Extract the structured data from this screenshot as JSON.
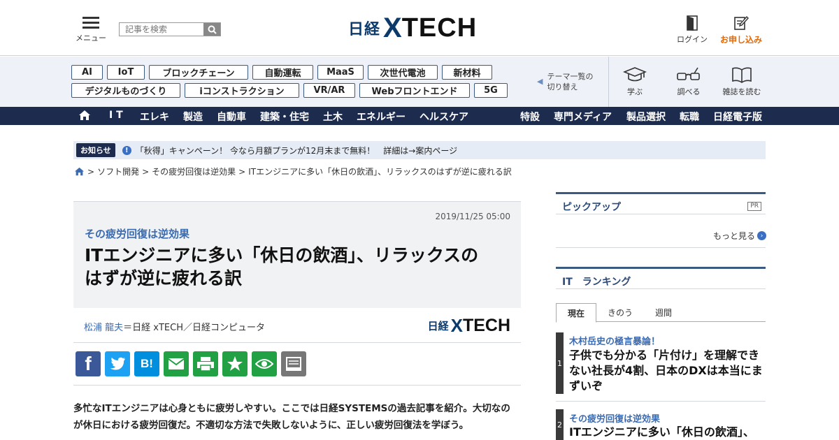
{
  "header": {
    "menu_label": "メニュー",
    "search_placeholder": "記事を検索",
    "logo_nikkei": "日経",
    "logo_x": "X",
    "logo_tech": "TECH",
    "login_label": "ログイン",
    "signup_label": "お申し込み"
  },
  "tags": {
    "row1": [
      "AI",
      "IoT",
      "ブロックチェーン",
      "自動運転",
      "MaaS",
      "次世代電池",
      "新材料"
    ],
    "row2": [
      "デジタルものづくり",
      "iコンストラクション",
      "VR/AR",
      "Webフロントエンド",
      "5G"
    ],
    "theme_switch_line1": "テーマ一覧の",
    "theme_switch_line2": "切り替え"
  },
  "quick_links": [
    {
      "label": "学ぶ",
      "icon": "graduation-cap-icon"
    },
    {
      "label": "調べる",
      "icon": "glasses-icon"
    },
    {
      "label": "雑誌を読む",
      "icon": "book-icon"
    }
  ],
  "nav": {
    "left": [
      "I T",
      "エレキ",
      "製造",
      "自動車",
      "建築・住宅",
      "土木",
      "エネルギー",
      "ヘルスケア"
    ],
    "right": [
      "特設",
      "専門メディア",
      "製品選択",
      "転職",
      "日経電子版"
    ]
  },
  "notice": {
    "badge": "お知らせ",
    "icon": "!",
    "text": "「秋得」キャンペーン！ 今なら月額プランが12月末まで無料！　詳細は→案内ページ"
  },
  "breadcrumb": [
    "ソフト開発",
    "その疲労回復は逆効果",
    "ITエンジニアに多い「休日の飲酒」、リラックスのはずが逆に疲れる訳"
  ],
  "breadcrumb_separator": ">",
  "article": {
    "date": "2019/11/25 05:00",
    "kicker": "その疲労回復は逆効果",
    "title_line1": "ITエンジニアに多い「休日の飲酒」、リラックスの",
    "title_line2": "はずが逆に疲れる訳",
    "author": "松浦 龍夫",
    "byline_rest": "＝日経 xTECH／日経コンピュータ",
    "lead_line1": "多忙なITエンジニアは心身ともに疲労しやすい。ここでは日経SYSTEMSの過去記事を紹介。大切なの",
    "lead_line2": "が休日における疲労回復だ。不適切な方法で失敗しないように、正しい疲労回復法を学ぼう。"
  },
  "share": {
    "facebook": "f",
    "hatena": "B!",
    "colors": {
      "facebook": "#3b5998",
      "twitter": "#1da1f2",
      "hatena": "#008fde",
      "mail": "#21a044",
      "print": "#21a044",
      "clip": "#21a044",
      "watch": "#21a044",
      "memo": "#777777"
    }
  },
  "sidebar": {
    "pickup_title": "ピックアップ",
    "pr_label": "PR",
    "more_label": "もっと見る",
    "ranking_title": "IT　ランキング",
    "tabs": [
      "現在",
      "きのう",
      "週間"
    ],
    "ranking": [
      {
        "rank": "1",
        "kicker": "木村岳史の極言暴論！",
        "title_line1": "子供でも分かる「片付け」を理解でき",
        "title_line2": "ない社長が4割、日本のDXは本当にま",
        "title_line3": "ずいぞ"
      },
      {
        "rank": "2",
        "kicker": "その疲労回復は逆効果",
        "title_line1": "ITエンジニアに多い「休日の飲酒」、"
      }
    ]
  },
  "colors": {
    "brand_navy": "#1d2b4f",
    "link_blue": "#3b6bb1",
    "accent_orange": "#e2690a"
  }
}
